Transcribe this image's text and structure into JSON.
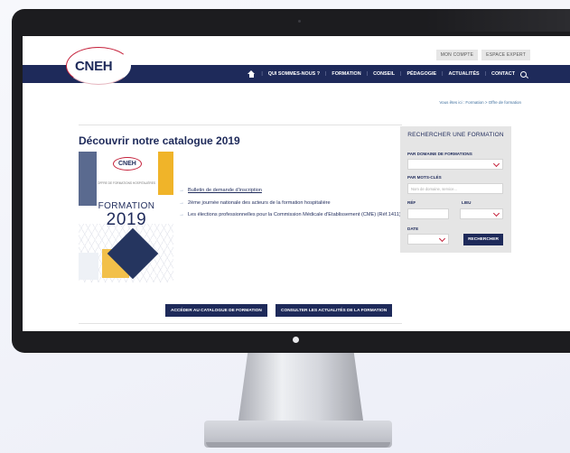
{
  "header": {
    "logo": "CNEH",
    "top_links": [
      "MON COMPTE",
      "ESPACE EXPERT"
    ],
    "nav": [
      "QUI SOMMES-NOUS ?",
      "FORMATION",
      "CONSEIL",
      "PÉDAGOGIE",
      "ACTUALITÉS",
      "CONTACT"
    ],
    "breadcrumb": "Vous êtes ici : Formation > Offre de formation"
  },
  "main": {
    "title": "Découvrir notre catalogue 2019",
    "cover": {
      "logo": "CNEH",
      "subtitle": "Offre de formations hospitalières",
      "formation": "FORMATION",
      "year": "2019"
    },
    "links": [
      "Bulletin de demande d'inscription",
      "2ème journée nationale des acteurs de la formation hospitalière",
      "Les élections professionnelles pour la Commission Médicale d'Etablissement (CME) (Réf.1411)"
    ],
    "buttons": [
      "ACCÉDER AU CATALOGUE DE FORMATION",
      "CONSULTER LES ACTUALITÉS DE LA FORMATION"
    ]
  },
  "search_panel": {
    "title": "RECHERCHER UNE FORMATION",
    "domain_label": "PAR DOMAINE DE FORMATIONS",
    "keywords_label": "PAR MOTS-CLÉS",
    "keywords_placeholder": "Nom de domaine, service...",
    "ref_label": "RÉF",
    "lieu_label": "LIEU",
    "date_label": "DATE",
    "search_button": "RECHERCHER"
  },
  "colors": {
    "navy": "#1e2a5a",
    "accent_red": "#c5203a",
    "accent_yellow": "#f0b429"
  }
}
